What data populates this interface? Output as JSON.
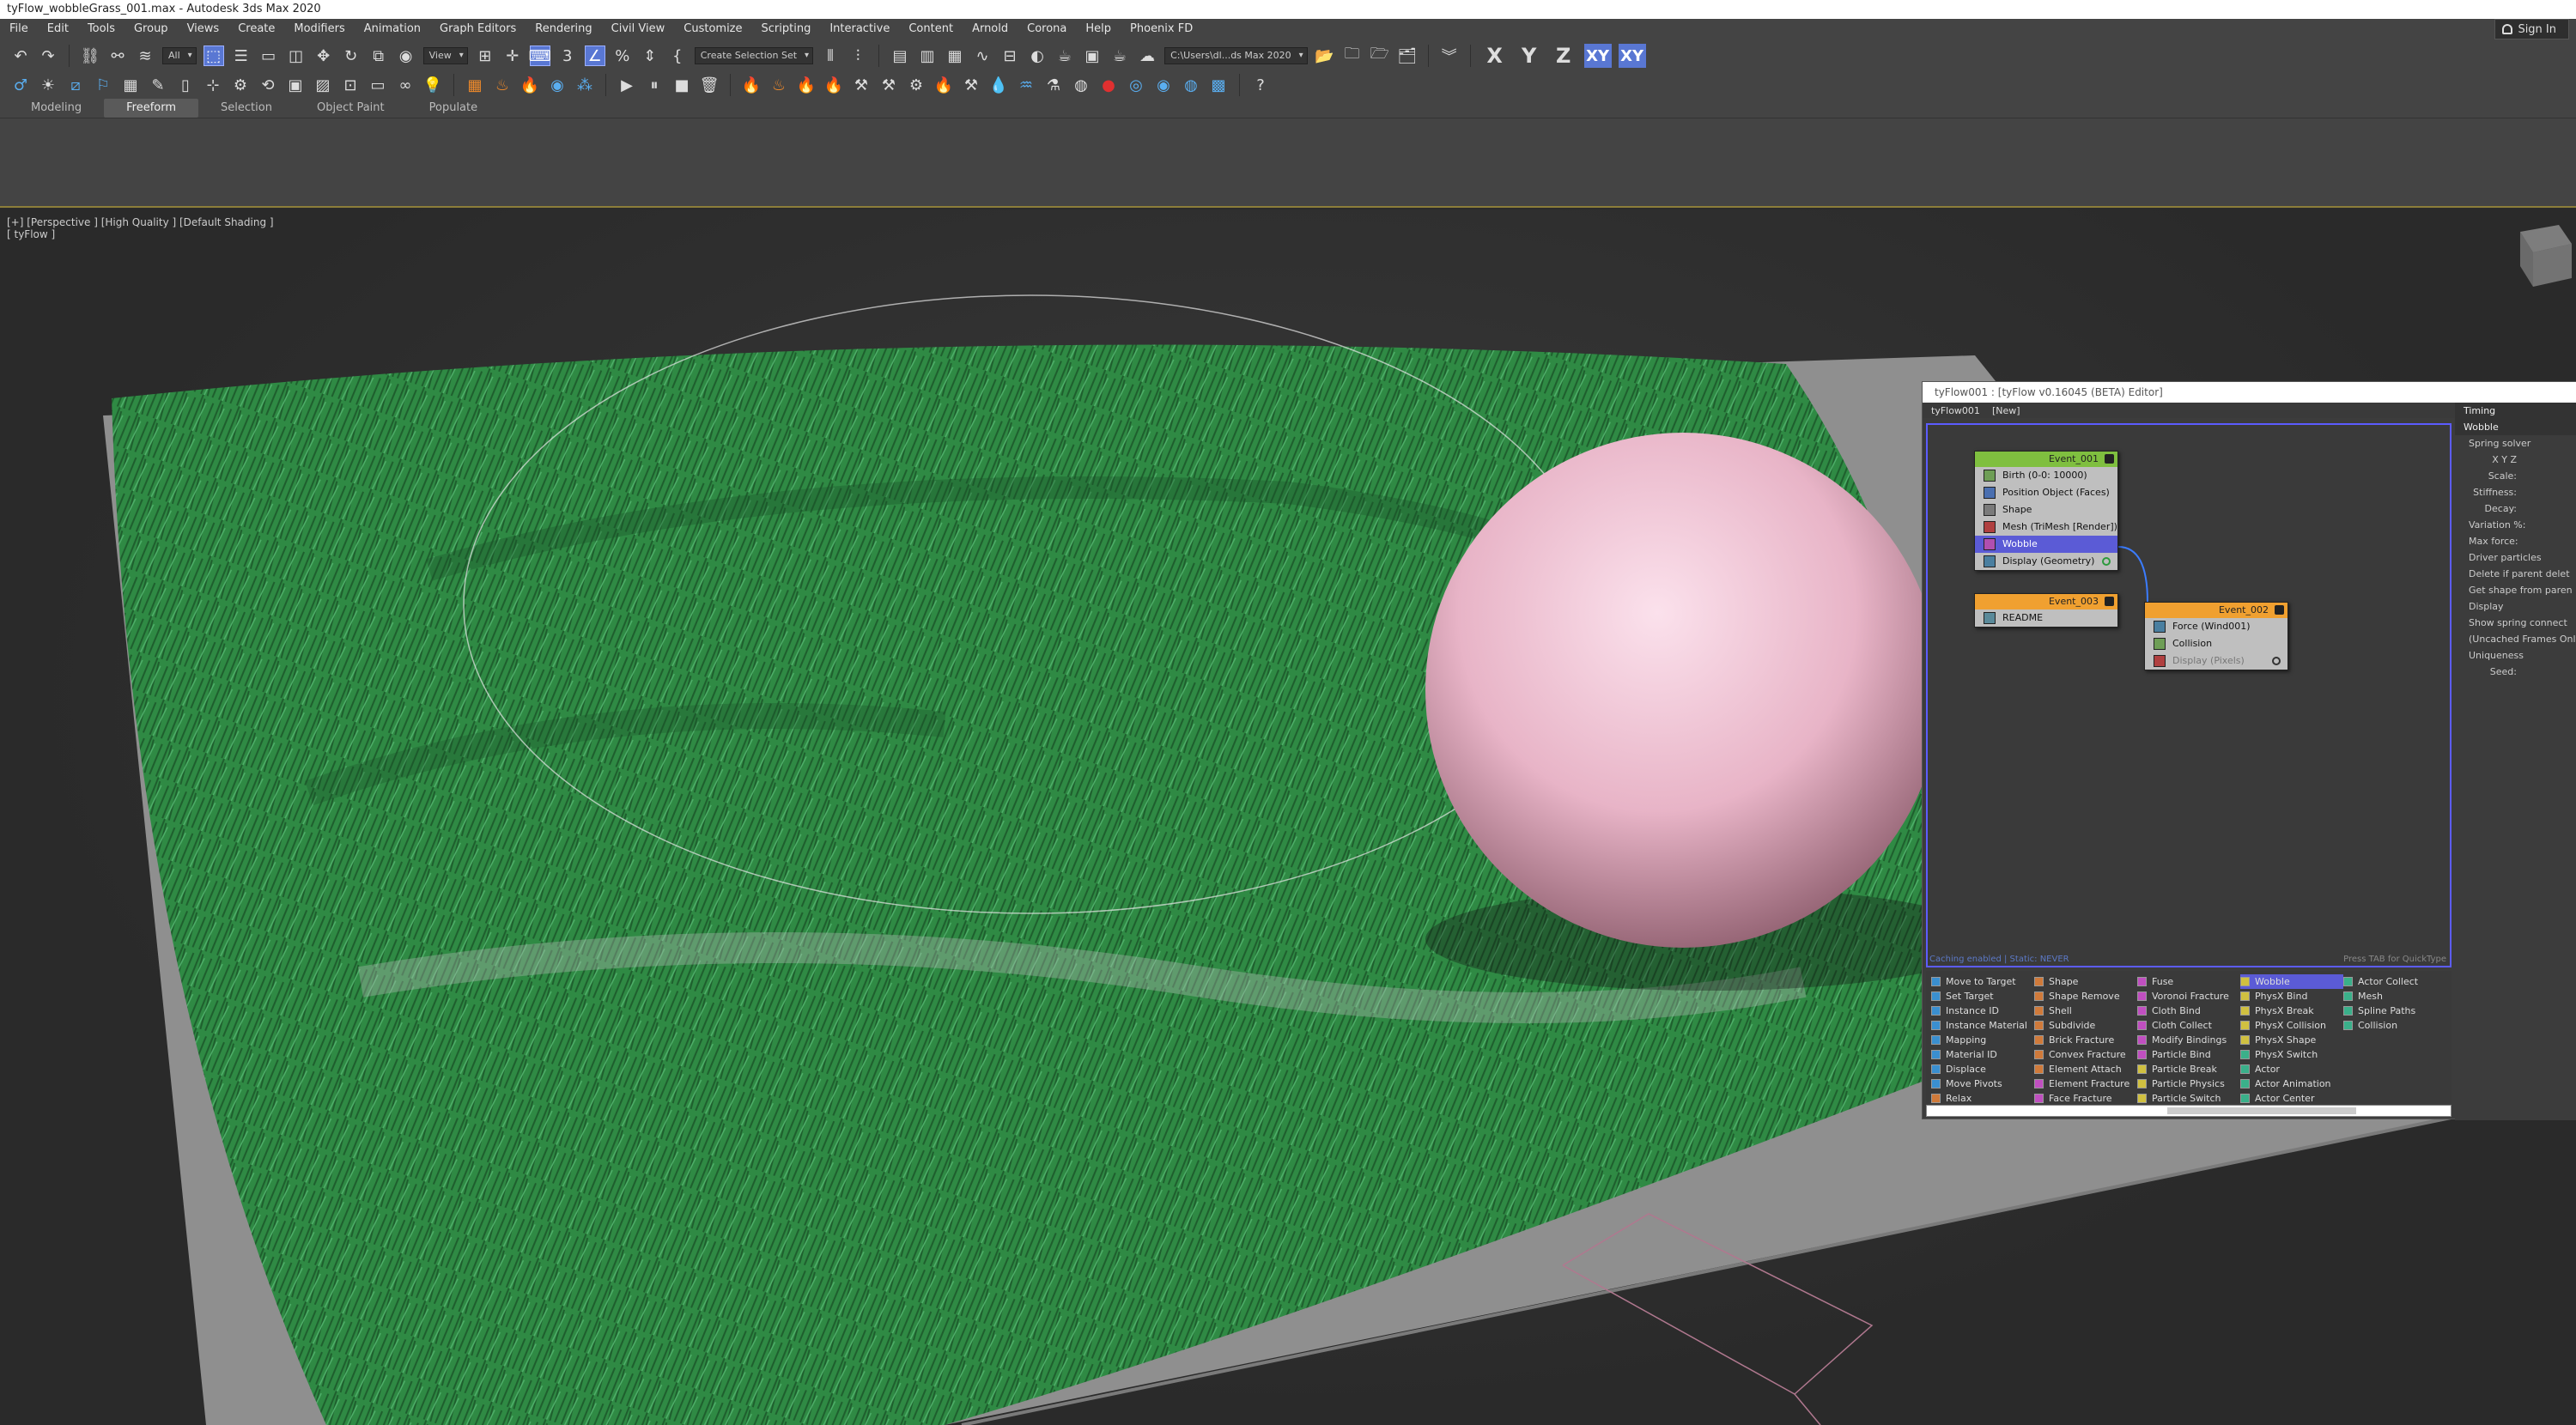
{
  "window": {
    "title": "tyFlow_wobbleGrass_001.max - Autodesk 3ds Max 2020"
  },
  "menubar": {
    "items": [
      "File",
      "Edit",
      "Tools",
      "Group",
      "Views",
      "Create",
      "Modifiers",
      "Animation",
      "Graph Editors",
      "Rendering",
      "Civil View",
      "Customize",
      "Scripting",
      "Interactive",
      "Content",
      "Arnold",
      "Corona",
      "Help",
      "Phoenix FD"
    ],
    "sign_in": "Sign In"
  },
  "toolbar": {
    "selection_filter": "All",
    "ref_coord": "View",
    "selection_set": "Create Selection Set",
    "project_path": "C:\\Users\\dl...ds Max 2020",
    "axis_x": "X",
    "axis_y": "Y",
    "axis_z": "Z",
    "axis_xy1": "XY",
    "axis_xy2": "XY"
  },
  "ribbon": {
    "tabs": [
      "Modeling",
      "Freeform",
      "Selection",
      "Object Paint",
      "Populate"
    ],
    "active": 1
  },
  "viewport": {
    "label": "[+] [Perspective ] [High Quality ] [Default Shading ]",
    "sublabel": "[ tyFlow ]"
  },
  "colors": {
    "grass": "#2f8a44",
    "sphere": "#e8b4c7",
    "accent": "#5977d3",
    "event_green": "#7fbf3f",
    "event_orange": "#f0a030"
  },
  "tyflow": {
    "title": "tyFlow001 : [tyFlow v0.16045 (BETA) Editor]",
    "tabs": [
      "tyFlow001",
      "[New]"
    ],
    "status": "Caching enabled | Static: NEVER",
    "hint": "Press TAB for QuickType",
    "events": [
      {
        "name": "Event_001",
        "ops": [
          "Birth (0-0: 10000)",
          "Position Object (Faces)",
          "Shape",
          "Mesh (TriMesh [Render])",
          "Wobble",
          "Display (Geometry)"
        ]
      },
      {
        "name": "Event_003",
        "ops": [
          "README"
        ]
      },
      {
        "name": "Event_002",
        "ops": [
          "Force (Wind001)",
          "Collision",
          "Display (Pixels)"
        ]
      }
    ],
    "properties": {
      "timing": "Timing",
      "wobble": "Wobble",
      "spring_solver": "Spring solver",
      "axes": "X  Y  Z",
      "fields": [
        "Scale:",
        "Stiffness:",
        "Decay:",
        "Variation %:",
        "Max force:"
      ],
      "driver": "Driver particles",
      "delete_parent": "Delete if parent delet",
      "get_shape": "Get shape from paren",
      "display": "Display",
      "show_spring": "Show spring connect",
      "uncached": "(Uncached Frames Only",
      "uniqueness": "Uniqueness",
      "seed": "Seed:"
    },
    "library": [
      "Move to Target",
      "Set Target",
      "Instance ID",
      "Instance Material",
      "Mapping",
      "Material ID",
      "Displace",
      "Move Pivots",
      "Relax",
      "Shape",
      "Shape Remove",
      "Shell",
      "Subdivide",
      "Brick Fracture",
      "Convex Fracture",
      "Element Attach",
      "Element Fracture",
      "Face Fracture",
      "Fuse",
      "Voronoi Fracture",
      "Cloth Bind",
      "Cloth Collect",
      "Modify Bindings",
      "Particle Bind",
      "Particle Break",
      "Particle Physics",
      "Particle Switch",
      "Wobble",
      "PhysX Bind",
      "PhysX Break",
      "PhysX Collision",
      "PhysX Shape",
      "PhysX Switch",
      "Actor",
      "Actor Animation",
      "Actor Center",
      "Actor Collect",
      "Mesh",
      "Spline Paths",
      "Collision"
    ]
  }
}
